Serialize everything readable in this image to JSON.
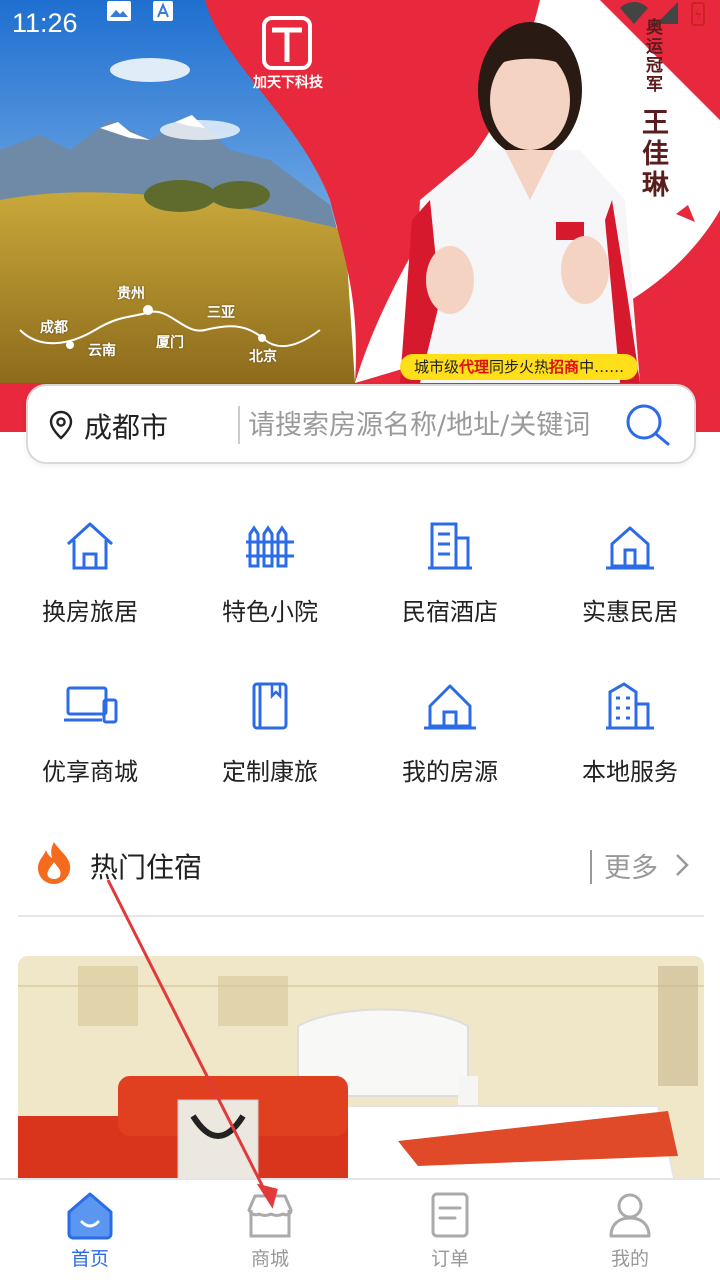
{
  "statusbar": {
    "time": "11:26"
  },
  "banner": {
    "brand": "加天下科技",
    "vertical_top": "奥运冠军",
    "vertical_name": "王佳琳",
    "pill_prefix": "城市级",
    "pill_agent": "代理",
    "pill_mid": "同步火热",
    "pill_invite": "招商",
    "pill_suffix": "中……",
    "map_labels": [
      "成都",
      "云南",
      "贵州",
      "厦门",
      "三亚",
      "北京"
    ]
  },
  "search": {
    "city": "成都市",
    "placeholder": "请搜索房源名称/地址/关键词"
  },
  "categories": [
    {
      "label": "换房旅居",
      "icon": "house-icon"
    },
    {
      "label": "特色小院",
      "icon": "fence-icon"
    },
    {
      "label": "民宿酒店",
      "icon": "building-icon"
    },
    {
      "label": "实惠民居",
      "icon": "home-small-icon"
    },
    {
      "label": "优享商城",
      "icon": "devices-icon"
    },
    {
      "label": "定制康旅",
      "icon": "book-icon"
    },
    {
      "label": "我的房源",
      "icon": "my-house-icon"
    },
    {
      "label": "本地服务",
      "icon": "city-icon"
    }
  ],
  "hot": {
    "title": "热门住宿",
    "more": "更多"
  },
  "tabs": [
    {
      "label": "首页",
      "icon": "home-tab-icon",
      "active": true
    },
    {
      "label": "商城",
      "icon": "shop-tab-icon",
      "active": false
    },
    {
      "label": "订单",
      "icon": "order-tab-icon",
      "active": false
    },
    {
      "label": "我的",
      "icon": "user-tab-icon",
      "active": false
    }
  ],
  "colors": {
    "accent": "#2b6be8",
    "brand_red": "#e8283c",
    "pill": "#ffde1a"
  }
}
